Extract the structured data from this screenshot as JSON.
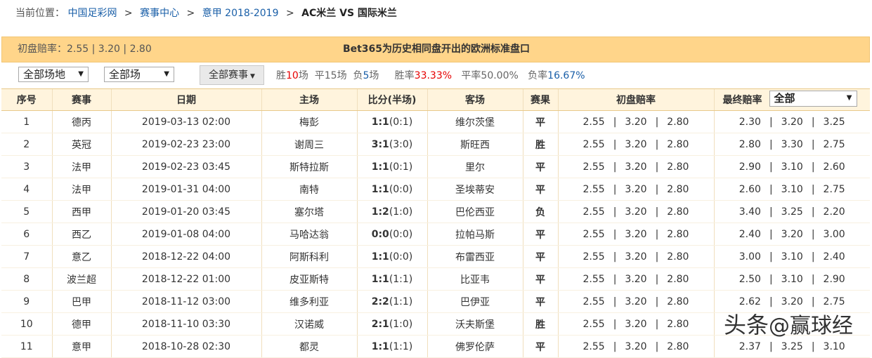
{
  "breadcrumb": {
    "label": "当前位置：",
    "items": [
      "中国足彩网",
      "赛事中心",
      "意甲 2018-2019"
    ],
    "separator": ">",
    "current": "AC米兰 VS 国际米兰"
  },
  "odds_bar": {
    "initial_label": "初盘赔率：",
    "initial_values": "2.55 | 3.20 | 2.80",
    "title": "Bet365为历史相同盘开出的欧洲标准盘口"
  },
  "filters": {
    "venue_select": "全部场地",
    "match_select": "全部场",
    "league_button": "全部赛事",
    "stats": {
      "win_label": "胜",
      "win_count": "10",
      "win_unit": "场",
      "draw_label": "平",
      "draw_count": "15",
      "draw_unit": "场",
      "lose_label": "负",
      "lose_count": "5",
      "lose_unit": "场",
      "win_rate_label": "胜率",
      "win_rate": "33.33%",
      "draw_rate_label": "平率",
      "draw_rate": "50.00%",
      "lose_rate_label": "负率",
      "lose_rate": "16.67%"
    }
  },
  "table": {
    "headers": [
      "序号",
      "赛事",
      "日期",
      "主场",
      "比分(半场)",
      "客场",
      "赛果",
      "初盘赔率",
      "最终赔率"
    ],
    "final_select": "全部",
    "rows": [
      {
        "no": "1",
        "league": "德丙",
        "date": "2019-03-13 02:00",
        "home": "梅彭",
        "score": "1:1",
        "half": "(0:1)",
        "away": "维尔茨堡",
        "result": "平",
        "init": [
          "2.55",
          "3.20",
          "2.80"
        ],
        "final": [
          "2.30",
          "3.20",
          "3.25"
        ]
      },
      {
        "no": "2",
        "league": "英冠",
        "date": "2019-02-23 23:00",
        "home": "谢周三",
        "score": "3:1",
        "half": "(3:0)",
        "away": "斯旺西",
        "result": "胜",
        "init": [
          "2.55",
          "3.20",
          "2.80"
        ],
        "final": [
          "2.80",
          "3.30",
          "2.75"
        ]
      },
      {
        "no": "3",
        "league": "法甲",
        "date": "2019-02-23 03:45",
        "home": "斯特拉斯",
        "score": "1:1",
        "half": "(0:1)",
        "away": "里尔",
        "result": "平",
        "init": [
          "2.55",
          "3.20",
          "2.80"
        ],
        "final": [
          "2.90",
          "3.10",
          "2.60"
        ]
      },
      {
        "no": "4",
        "league": "法甲",
        "date": "2019-01-31 04:00",
        "home": "南特",
        "score": "1:1",
        "half": "(0:0)",
        "away": "圣埃蒂安",
        "result": "平",
        "init": [
          "2.55",
          "3.20",
          "2.80"
        ],
        "final": [
          "2.60",
          "3.10",
          "2.75"
        ]
      },
      {
        "no": "5",
        "league": "西甲",
        "date": "2019-01-20 03:45",
        "home": "塞尔塔",
        "score": "1:2",
        "half": "(1:0)",
        "away": "巴伦西亚",
        "result": "负",
        "init": [
          "2.55",
          "3.20",
          "2.80"
        ],
        "final": [
          "3.40",
          "3.25",
          "2.20"
        ]
      },
      {
        "no": "6",
        "league": "西乙",
        "date": "2019-01-08 04:00",
        "home": "马哈达翁",
        "score": "0:0",
        "half": "(0:0)",
        "away": "拉帕马斯",
        "result": "平",
        "init": [
          "2.55",
          "3.20",
          "2.80"
        ],
        "final": [
          "2.40",
          "3.20",
          "3.00"
        ]
      },
      {
        "no": "7",
        "league": "意乙",
        "date": "2018-12-22 04:00",
        "home": "阿斯科利",
        "score": "1:1",
        "half": "(0:0)",
        "away": "布雷西亚",
        "result": "平",
        "init": [
          "2.55",
          "3.20",
          "2.80"
        ],
        "final": [
          "3.00",
          "3.10",
          "2.40"
        ]
      },
      {
        "no": "8",
        "league": "波兰超",
        "date": "2018-12-22 01:00",
        "home": "皮亚斯特",
        "score": "1:1",
        "half": "(1:1)",
        "away": "比亚韦",
        "result": "平",
        "init": [
          "2.55",
          "3.20",
          "2.80"
        ],
        "final": [
          "2.50",
          "3.10",
          "2.90"
        ]
      },
      {
        "no": "9",
        "league": "巴甲",
        "date": "2018-11-12 03:00",
        "home": "维多利亚",
        "score": "2:2",
        "half": "(1:1)",
        "away": "巴伊亚",
        "result": "平",
        "init": [
          "2.55",
          "3.20",
          "2.80"
        ],
        "final": [
          "2.62",
          "3.20",
          "2.75"
        ]
      },
      {
        "no": "10",
        "league": "德甲",
        "date": "2018-11-10 03:30",
        "home": "汉诺威",
        "score": "2:1",
        "half": "(1:0)",
        "away": "沃夫斯堡",
        "result": "胜",
        "init": [
          "2.55",
          "3.20",
          "2.80"
        ],
        "final": [
          "",
          "",
          ""
        ]
      },
      {
        "no": "11",
        "league": "意甲",
        "date": "2018-10-28 02:30",
        "home": "都灵",
        "score": "1:1",
        "half": "(1:1)",
        "away": "佛罗伦萨",
        "result": "平",
        "init": [
          "2.55",
          "3.20",
          "2.80"
        ],
        "final": [
          "2.37",
          "3.25",
          "3.10"
        ]
      }
    ]
  },
  "watermark": {
    "part1": "头条",
    "part2": "@赢球经"
  },
  "colors": {
    "win": "#e60000",
    "lose": "#1a5fa8",
    "odds_bar_bg": "#ffd58a",
    "header_bg": "#fff4dd"
  }
}
